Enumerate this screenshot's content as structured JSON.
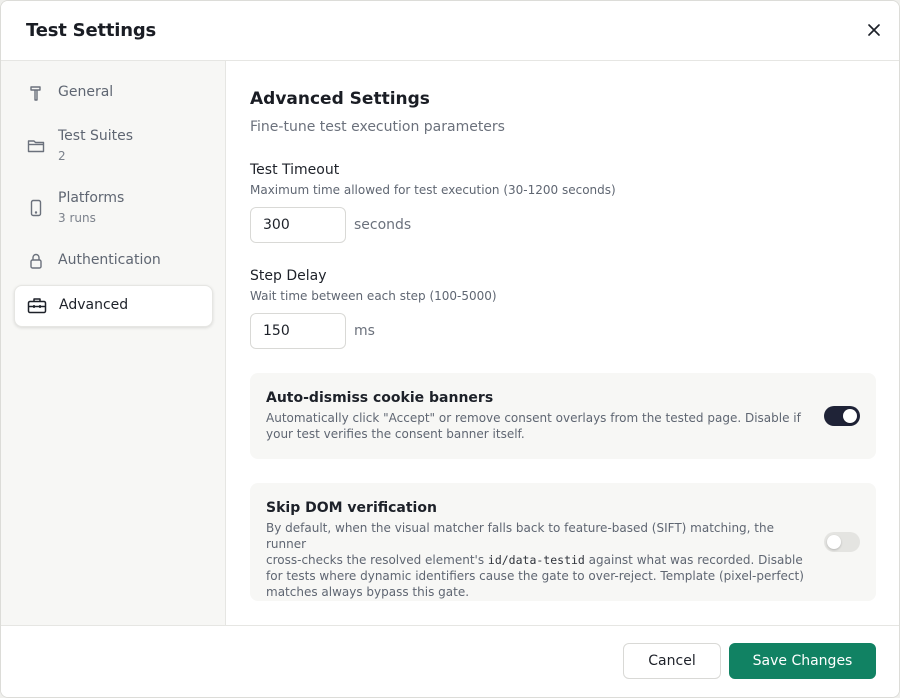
{
  "dialog": {
    "title": "Test Settings",
    "close_icon": "close-icon"
  },
  "sidebar": {
    "items": [
      {
        "id": "general",
        "label": "General",
        "sub": "",
        "icon": "hammer-icon"
      },
      {
        "id": "test-suites",
        "label": "Test Suites",
        "sub": "2",
        "icon": "folder-icon"
      },
      {
        "id": "platforms",
        "label": "Platforms",
        "sub": "3 runs",
        "icon": "smartphone-icon"
      },
      {
        "id": "authentication",
        "label": "Authentication",
        "sub": "",
        "icon": "lock-icon"
      },
      {
        "id": "advanced",
        "label": "Advanced",
        "sub": "",
        "icon": "briefcase-icon",
        "active": true
      }
    ]
  },
  "content": {
    "title": "Advanced Settings",
    "subtitle": "Fine-tune test execution parameters",
    "timeout": {
      "label": "Test Timeout",
      "help": "Maximum time allowed for test execution (30-1200 seconds)",
      "value": "300",
      "unit": "seconds"
    },
    "step_delay": {
      "label": "Step Delay",
      "help": "Wait time between each step (100-5000)",
      "value": "150",
      "unit": "ms"
    },
    "cookie": {
      "title": "Auto-dismiss cookie banners",
      "desc_line1": "Automatically click \"Accept\" or remove consent overlays from the tested page. Disable if",
      "desc_line2": "your test verifies the consent banner itself.",
      "enabled": true
    },
    "dom": {
      "title": "Skip DOM verification",
      "desc_line1": "By default, when the visual matcher falls back to feature-based (SIFT) matching, the runner",
      "desc_line2a": "cross-checks the resolved element's ",
      "desc_code": "id/data-testid",
      "desc_line2b": " against what was recorded. Disable",
      "desc_line3": "for tests where dynamic identifiers cause the gate to over-reject. Template (pixel-perfect)",
      "desc_line4": "matches always bypass this gate.",
      "enabled": false
    }
  },
  "footer": {
    "cancel_label": "Cancel",
    "save_label": "Save Changes"
  },
  "colors": {
    "accent": "#118263",
    "toggle_on": "#1f2337",
    "toggle_off": "#e4e4e1"
  }
}
